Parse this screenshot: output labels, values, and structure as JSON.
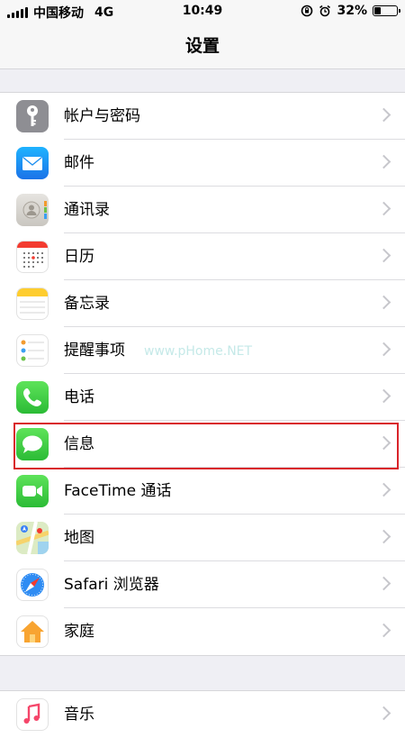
{
  "status": {
    "carrier": "中国移动",
    "network": "4G",
    "time": "10:49",
    "battery_text": "32%",
    "battery_level": 0.32
  },
  "nav": {
    "title": "设置"
  },
  "items": [
    {
      "label": "帐户与密码",
      "icon": "key-icon"
    },
    {
      "label": "邮件",
      "icon": "mail-icon"
    },
    {
      "label": "通讯录",
      "icon": "contacts-icon"
    },
    {
      "label": "日历",
      "icon": "calendar-icon"
    },
    {
      "label": "备忘录",
      "icon": "notes-icon"
    },
    {
      "label": "提醒事项",
      "icon": "reminders-icon"
    },
    {
      "label": "电话",
      "icon": "phone-icon"
    },
    {
      "label": "信息",
      "icon": "messages-icon"
    },
    {
      "label": "FaceTime 通话",
      "icon": "facetime-icon"
    },
    {
      "label": "地图",
      "icon": "maps-icon"
    },
    {
      "label": "Safari 浏览器",
      "icon": "safari-icon"
    },
    {
      "label": "家庭",
      "icon": "home-icon"
    }
  ],
  "next_group": {
    "label": "音乐",
    "icon": "music-icon"
  },
  "watermark": "www.pHome.NET",
  "colors": {
    "highlight": "#d9242a"
  }
}
